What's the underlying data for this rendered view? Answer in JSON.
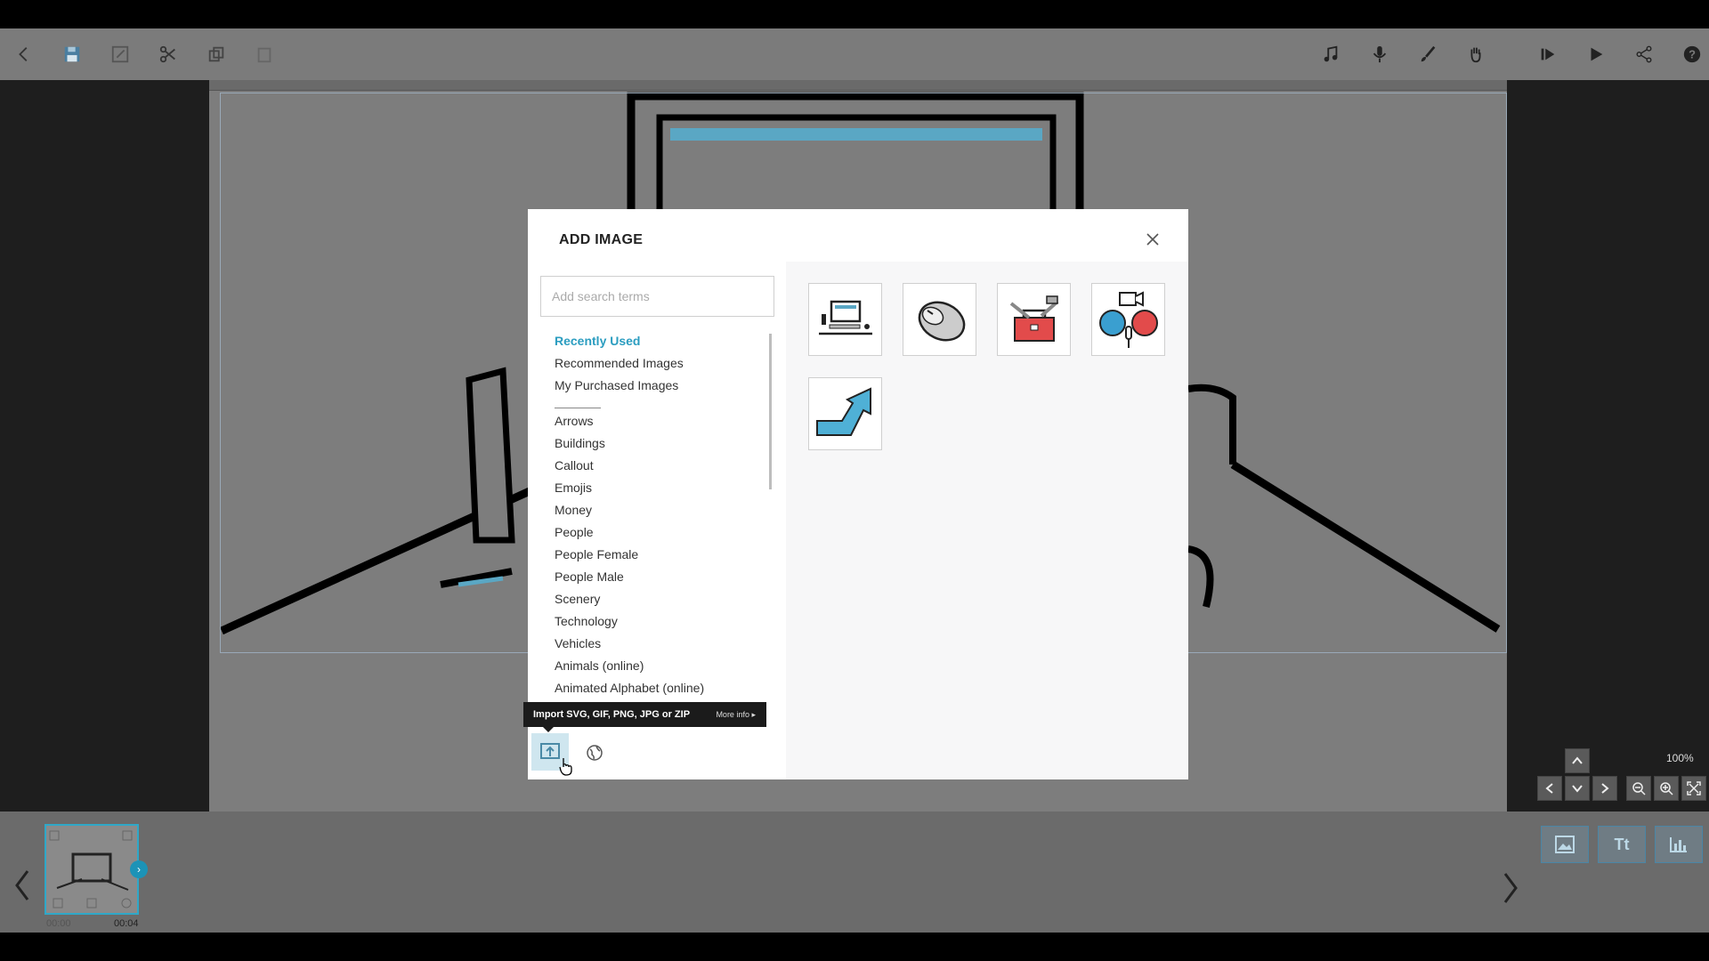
{
  "toolbar": {
    "left_icons": [
      "back-icon",
      "save-icon",
      "save-as-icon",
      "cut-icon",
      "copy-icon",
      "paste-icon"
    ],
    "right_icons": [
      "music-icon",
      "microphone-icon",
      "brush-icon",
      "hand-icon",
      "play-from-icon",
      "play-icon",
      "share-icon",
      "help-icon"
    ]
  },
  "dialog": {
    "title": "ADD IMAGE",
    "search_placeholder": "Add search terms",
    "categories_top": [
      "Recently Used",
      "Recommended Images",
      "My Purchased Images"
    ],
    "active_category": "Recently Used",
    "categories": [
      "Arrows",
      "Buildings",
      "Callout",
      "Emojis",
      "Money",
      "People",
      "People Female",
      "People Male",
      "Scenery",
      "Technology",
      "Vehicles",
      "Animals (online)",
      "Animated Alphabet (online)"
    ],
    "tooltip": "Import SVG, GIF, PNG, JPG or ZIP",
    "tooltip_more": "More info",
    "images": [
      "computer-desk-image",
      "computer-mouse-image",
      "toolbox-image",
      "video-interview-image",
      "arrow-up-right-image"
    ]
  },
  "timeline": {
    "start_time": "00:00",
    "end_time": "00:04",
    "add_buttons": [
      "image-icon",
      "Tt",
      "chart-icon"
    ]
  },
  "zoom": {
    "level": "100%"
  },
  "colors": {
    "accent": "#2b9dc0",
    "toolbar_bg": "#7b7b7b",
    "canvas_bg": "#7d7d7d",
    "tooltip_bg": "#1b1b1b"
  }
}
